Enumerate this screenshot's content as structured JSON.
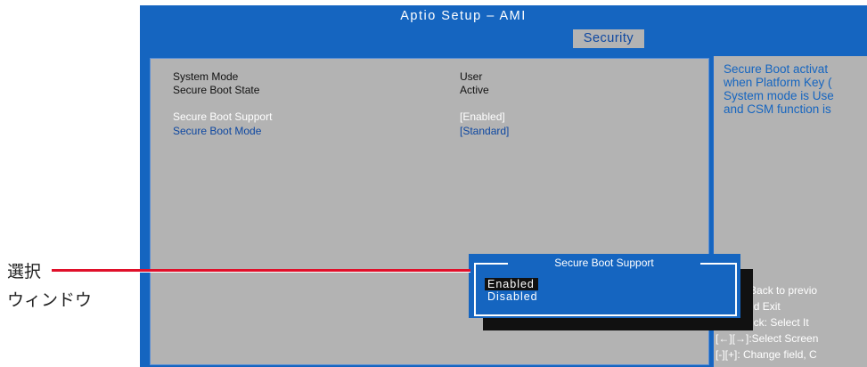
{
  "header": {
    "title": "Aptio Setup  –  AMI",
    "active_tab": "Security"
  },
  "settings": [
    {
      "label": "System Mode",
      "value": "User"
    },
    {
      "label": "Secure Boot State",
      "value": "Active"
    },
    {
      "label": "Secure Boot Support",
      "value": "[Enabled]"
    },
    {
      "label": "Secure Boot Mode",
      "value": "[Standard]"
    }
  ],
  "help": {
    "lines": [
      "Secure Boot activat",
      "when Platform Key (",
      "System mode is Use",
      "and CSM function is"
    ]
  },
  "keys": [
    "[ESC]: Back to previo",
    "nges and Exit",
    "[↑][↓]/Click: Select It",
    "[←][→]:Select Screen",
    "[-][+]: Change field, C"
  ],
  "dialog": {
    "title": "Secure Boot Support",
    "options": [
      "Enabled",
      "Disabled"
    ],
    "selected": "Enabled"
  },
  "annotation": {
    "line1": "選択",
    "line2": "ウィンドウ"
  },
  "colors": {
    "bios_blue": "#1565c0",
    "panel_gray": "#b3b3b3",
    "annotation_red": "#e0102a"
  }
}
